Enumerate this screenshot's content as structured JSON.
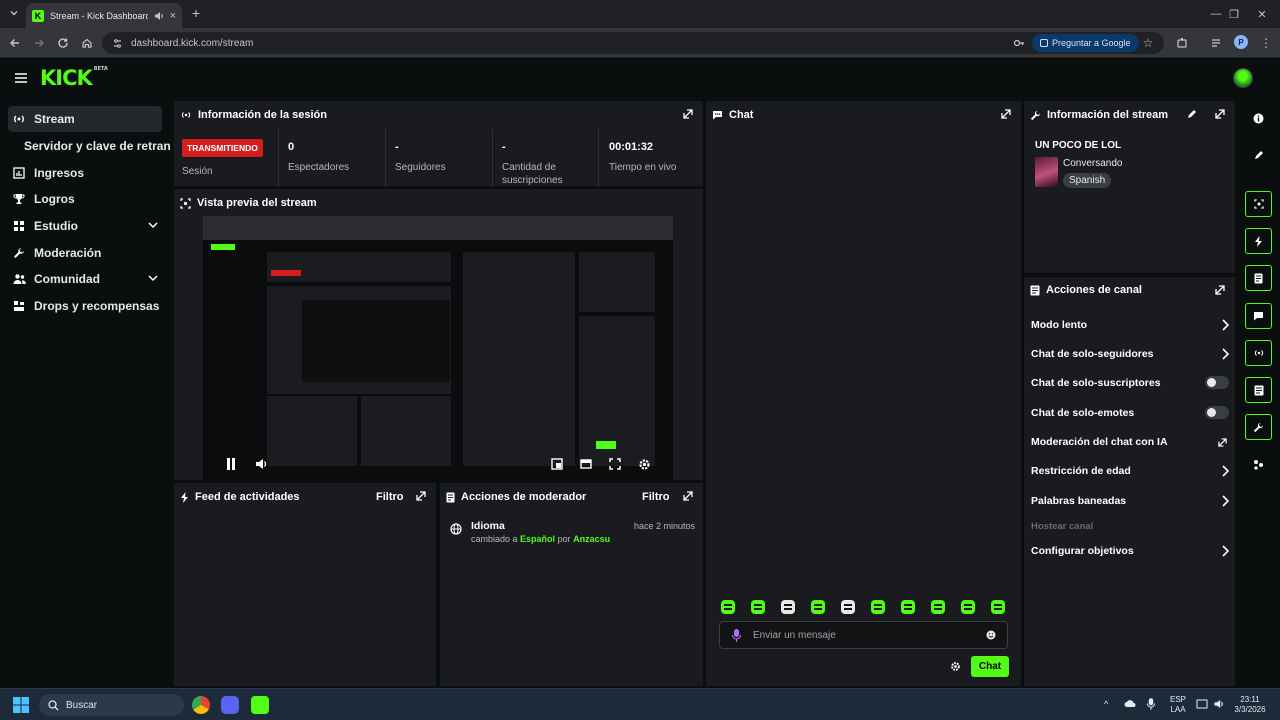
{
  "browser": {
    "tab_title": "Stream - Kick Dashboard",
    "url": "dashboard.kick.com/stream",
    "ask_google": "Preguntar a Google",
    "profile_initial": "P"
  },
  "brand": {
    "logo": "KICK",
    "beta": "BETA",
    "accent": "#53fc18"
  },
  "sidebar": {
    "items": [
      {
        "label": "Stream",
        "icon": "broadcast-icon"
      },
      {
        "label": "Servidor y clave de retransmisión"
      },
      {
        "label": "Ingresos",
        "icon": "chart-icon"
      },
      {
        "label": "Logros",
        "icon": "trophy-icon"
      },
      {
        "label": "Estudio",
        "icon": "grid-icon"
      },
      {
        "label": "Moderación",
        "icon": "wrench-icon"
      },
      {
        "label": "Comunidad",
        "icon": "users-icon"
      },
      {
        "label": "Drops y recompensas",
        "icon": "drops-icon"
      }
    ]
  },
  "session": {
    "title": "Información de la sesión",
    "status_badge": "TRANSMITIENDO",
    "status_label": "Sesión",
    "viewers_value": "0",
    "viewers_label": "Espectadores",
    "followers_value": "-",
    "followers_label": "Seguidores",
    "subs_value": "-",
    "subs_label_1": "Cantidad de",
    "subs_label_2": "suscripciones",
    "uptime_value": "00:01:32",
    "uptime_label": "Tiempo en vivo"
  },
  "preview": {
    "title": "Vista previa del stream"
  },
  "activity": {
    "title": "Feed de actividades",
    "filter": "Filtro"
  },
  "moderator": {
    "title": "Acciones de moderador",
    "filter": "Filtro",
    "entry_title": "Idioma",
    "entry_time": "hace 2 minutos",
    "entry_text_1": "cambiado a",
    "entry_value": "Español",
    "entry_text_2": "por",
    "entry_user": "Anzacsu"
  },
  "chat": {
    "title": "Chat",
    "placeholder": "Enviar un mensaje",
    "send_label": "Chat"
  },
  "stream_info": {
    "title": "Información del stream",
    "stream_title": "UN POCO DE LOL",
    "category": "Conversando",
    "language": "Spanish"
  },
  "channel_actions": {
    "title": "Acciones de canal",
    "items": [
      {
        "label": "Modo lento",
        "control": "chevron"
      },
      {
        "label": "Chat de solo-seguidores",
        "control": "chevron"
      },
      {
        "label": "Chat de solo-suscriptores",
        "control": "toggle",
        "enabled": false
      },
      {
        "label": "Chat de solo-emotes",
        "control": "toggle",
        "enabled": false
      },
      {
        "label": "Moderación del chat con IA",
        "control": "external"
      },
      {
        "label": "Restricción de edad",
        "control": "chevron"
      },
      {
        "label": "Palabras baneadas",
        "control": "chevron"
      },
      {
        "label": "Hostear canal",
        "control": "none",
        "disabled": true
      },
      {
        "label": "Configurar objetivos",
        "control": "chevron"
      }
    ]
  },
  "taskbar": {
    "search_placeholder": "Buscar",
    "lang_1": "ESP",
    "lang_2": "LAA",
    "time": "23:11",
    "date": "3/3/2026"
  }
}
